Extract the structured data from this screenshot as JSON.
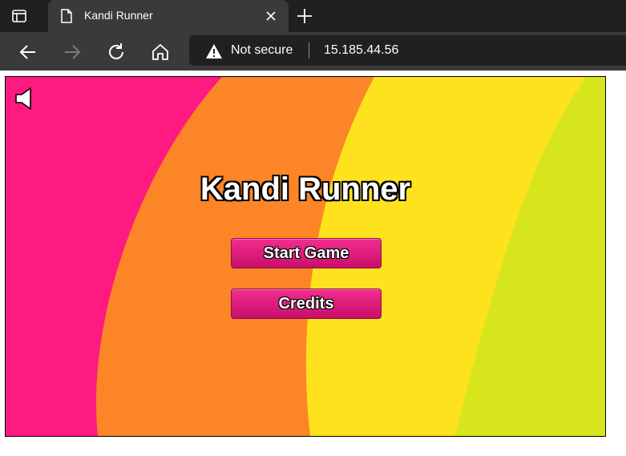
{
  "browser": {
    "tab_title": "Kandi Runner",
    "address_warning": "Not secure",
    "url": "15.185.44.56"
  },
  "icons": {
    "tab_actions": "tab-actions-icon",
    "favicon": "page-icon",
    "close": "close-icon",
    "new_tab": "plus-icon",
    "back": "back-arrow-icon",
    "forward": "forward-arrow-icon",
    "reload": "reload-icon",
    "home": "home-icon",
    "warning": "warning-icon",
    "sound": "speaker-icon"
  },
  "game": {
    "title": "Kandi Runner",
    "buttons": {
      "start": "Start Game",
      "credits": "Credits"
    },
    "colors": {
      "pink": "#fe1a80",
      "orange": "#fb8527",
      "yellow": "#fee21e",
      "lime": "#d7e61c",
      "button": "#e01a7a"
    }
  }
}
